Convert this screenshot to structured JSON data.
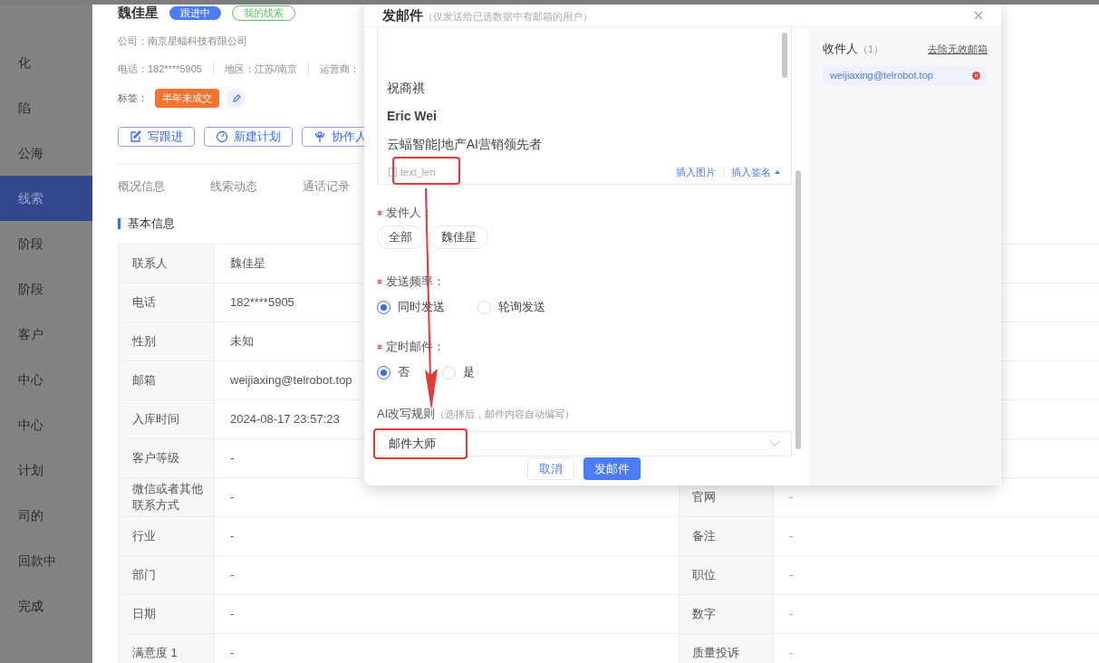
{
  "sidebar": {
    "items": [
      {
        "label": "化",
        "selected": false
      },
      {
        "label": "陷",
        "selected": false
      },
      {
        "label": "公海",
        "selected": false
      },
      {
        "label": "线索",
        "selected": true
      },
      {
        "label": "阶段",
        "selected": false
      },
      {
        "label": "阶段",
        "selected": false
      },
      {
        "label": "客户",
        "selected": false
      },
      {
        "label": "中心",
        "selected": false
      },
      {
        "label": "中心",
        "selected": false
      },
      {
        "label": "计划",
        "selected": false
      },
      {
        "label": "司的",
        "selected": false
      },
      {
        "label": "回款中",
        "selected": false
      },
      {
        "label": "完成",
        "selected": false
      }
    ]
  },
  "lead": {
    "name": "魏佳星",
    "badges": [
      {
        "label": "跟进中",
        "kind": "filled"
      },
      {
        "label": "我的线索",
        "kind": "outline"
      }
    ],
    "company": "公司：南京星蝠科技有限公司",
    "meta": [
      "电话：182****5905",
      "地区：江苏/南京",
      "运营商："
    ],
    "tags_label": "标签：",
    "tags": [
      "半年未成交"
    ],
    "actions": [
      {
        "label": "写跟进"
      },
      {
        "label": "新建计划"
      },
      {
        "label": "协作人"
      }
    ],
    "tabs": [
      {
        "label": "概况信息",
        "selected": false
      },
      {
        "label": "线索动态",
        "selected": false
      },
      {
        "label": "通话记录",
        "selected": false
      }
    ]
  },
  "section_title": "基本信息",
  "table": {
    "rows": [
      {
        "label": "联系人",
        "value": "魏佳星"
      },
      {
        "label": "电话",
        "value": "182****5905"
      },
      {
        "label": "性别",
        "value": "未知"
      },
      {
        "label": "邮箱",
        "value": "weijiaxing@telrobot.top"
      },
      {
        "label": "入库时间",
        "value": "2024-08-17 23:57:23"
      },
      {
        "label": "客户等级",
        "value": "-"
      },
      {
        "label": "微信或者其他联系方式",
        "value": "-",
        "label_2": "官网",
        "value_2": "-"
      },
      {
        "label": "行业",
        "value": "-",
        "label_2": "备注",
        "value_2": "-"
      },
      {
        "label": "部门",
        "value": "-",
        "label_2": "职位",
        "value_2": "-"
      },
      {
        "label": "日期",
        "value": "-",
        "label_2": "数字",
        "value_2": "-"
      },
      {
        "label": "满意度 1",
        "value": "-",
        "label_2": "质量投诉",
        "value_2": "-"
      }
    ]
  },
  "dialog": {
    "title": "发邮件",
    "subtitle": "（仅发送给已选数据中有邮箱的用户）",
    "editor": {
      "lines": [
        {
          "text": "祝商祺",
          "bold": false
        },
        {
          "text": "Eric Wei",
          "bold": true
        },
        {
          "text": "云蝠智能|地产AI营销领先者",
          "bold": false
        }
      ],
      "counter": "text_len",
      "links": [
        "插入图片",
        "插入签名"
      ]
    },
    "fields": [
      {
        "kind": "chips",
        "label": "发件人：",
        "required": true,
        "options": [
          {
            "label": "全部"
          },
          {
            "label": "魏佳星"
          }
        ]
      },
      {
        "kind": "radio",
        "label": "发送频率：",
        "required": true,
        "options": [
          {
            "label": "同时发送",
            "selected": true
          },
          {
            "label": "轮询发送",
            "selected": false
          }
        ]
      },
      {
        "kind": "radio",
        "label": "定时邮件：",
        "required": true,
        "options": [
          {
            "label": "否",
            "selected": true
          },
          {
            "label": "是",
            "selected": false
          }
        ]
      },
      {
        "kind": "select",
        "label": "AI改写规则",
        "required": false,
        "hint": "（选择后，邮件内容自动编写）",
        "value": "邮件大师"
      }
    ],
    "buttons": [
      {
        "label": "取消",
        "kind": "secondary"
      },
      {
        "label": "发邮件",
        "kind": "primary"
      }
    ],
    "recipients": {
      "title": "收件人",
      "count": "（1）",
      "action": "去除无效邮箱",
      "items": [
        "weijiaxing@telrobot.top"
      ]
    }
  }
}
